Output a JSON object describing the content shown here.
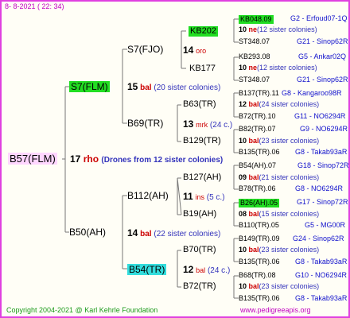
{
  "date": "8-  8-2021 ( 22:  34)",
  "footer": {
    "copyright": "Copyright 2004-2021 @ Karl Kehrle Foundation",
    "website": "www.pedigreeapis.org"
  },
  "root": {
    "name": "B57(FLM)",
    "num": "17",
    "tag": "rho",
    "desc": "(Drones from 12 sister colonies)"
  },
  "g2": [
    {
      "name": "S7(FLM)",
      "num": "15",
      "tag": "bal",
      "desc": "(20 sister colonies)"
    },
    {
      "name": "B50(AH)",
      "num": "14",
      "tag": "bal",
      "desc": "(22 sister colonies)"
    }
  ],
  "g3": [
    {
      "name": "S7(FJO)",
      "num": "14",
      "tag": "oro",
      "desc": ""
    },
    {
      "name": "B69(TR)",
      "num": "13",
      "tag": "mrk",
      "desc": "(24 c.)"
    },
    {
      "name": "B112(AH)",
      "num": "11",
      "tag": "ins",
      "desc": "(5 c.)"
    },
    {
      "name": "B54(TR)",
      "num": "12",
      "tag": "bal",
      "desc": "(24 c.)"
    }
  ],
  "g4": [
    {
      "name": "KB202"
    },
    {
      "name": "KB177"
    },
    {
      "name": "B63(TR)",
      "num": "12",
      "tag": "bal",
      "desc": "(24 sister colonies)"
    },
    {
      "name": "B129(TR)",
      "num": "10",
      "tag": "bal",
      "desc": "(23 sister colonies)"
    },
    {
      "name": "B127(AH)",
      "num": "09",
      "tag": "bal",
      "desc": "(21 sister colonies)"
    },
    {
      "name": "B19(AH)",
      "num": "08",
      "tag": "bal",
      "desc": "(15 sister colonies)"
    },
    {
      "name": "B70(TR)",
      "num": "10",
      "tag": "bal",
      "desc": "(23 sister colonies)"
    },
    {
      "name": "B72(TR)",
      "num": "10",
      "tag": "bal",
      "desc": "(23 sister colonies)"
    }
  ],
  "g5": [
    {
      "name": "KB048.09",
      "code": "G2 - Erfoud07-1Q"
    },
    {
      "name": "ST348.07",
      "code": "G21 - Sinop62R"
    },
    {
      "name": "KB293.08",
      "code": "G5 - Ankar02Q"
    },
    {
      "name": "ST348.07",
      "code": "G21 - Sinop62R"
    },
    {
      "name": "B137(TR).11",
      "code": "G8 - Kangaroo98R"
    },
    {
      "name": "B72(TR).10",
      "code": "G11 - NO6294R"
    },
    {
      "name": "B82(TR).07",
      "code": "G9 - NO6294R"
    },
    {
      "name": "B135(TR).06",
      "code": "G8 - Takab93aR"
    },
    {
      "name": "B54(AH).07",
      "code": "G18 - Sinop72R"
    },
    {
      "name": "B78(TR).06",
      "code": "G8 - NO6294R"
    },
    {
      "name": "B26(AH).05",
      "code": "G17 - Sinop72R"
    },
    {
      "name": "B110(TR).05",
      "code": "G5 - MG00R"
    },
    {
      "name": "B149(TR).09",
      "code": "G24 - Sinop62R"
    },
    {
      "name": "B135(TR).06",
      "code": "G8 - Takab93aR"
    },
    {
      "name": "B68(TR).08",
      "code": "G10 - NO6294R"
    },
    {
      "name": "B135(TR).06",
      "code": "G8 - Takab93aR"
    }
  ],
  "g4_sisters": [
    {
      "num": "10",
      "tag": "ne",
      "desc": "(12 sister colonies)"
    },
    {
      "num": "10",
      "tag": "ne",
      "desc": "(12 sister colonies)"
    }
  ]
}
